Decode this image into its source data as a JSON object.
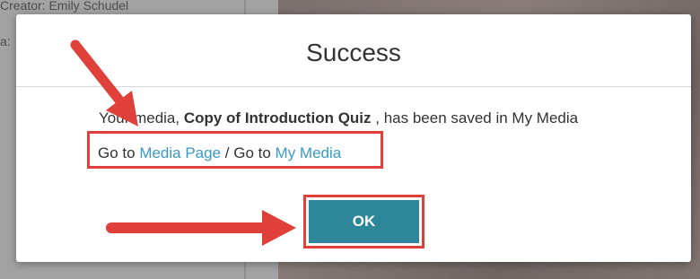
{
  "background": {
    "creator_text": "Creator: Emily Schudel",
    "second_text": "a:"
  },
  "dialog": {
    "title": "Success",
    "message_prefix": "Your media, ",
    "media_name": "Copy of Introduction Quiz",
    "message_suffix": " , has been saved in My Media",
    "goto_label_1": "Go to ",
    "media_page_link": "Media Page",
    "goto_separator": " / Go to ",
    "my_media_link": "My Media",
    "ok_label": "OK"
  },
  "colors": {
    "accent_button": "#2d8699",
    "link": "#3b99c7",
    "highlight": "#e0403a"
  },
  "icons": [
    "arrow-annotation-icon",
    "arrow-annotation-icon"
  ]
}
